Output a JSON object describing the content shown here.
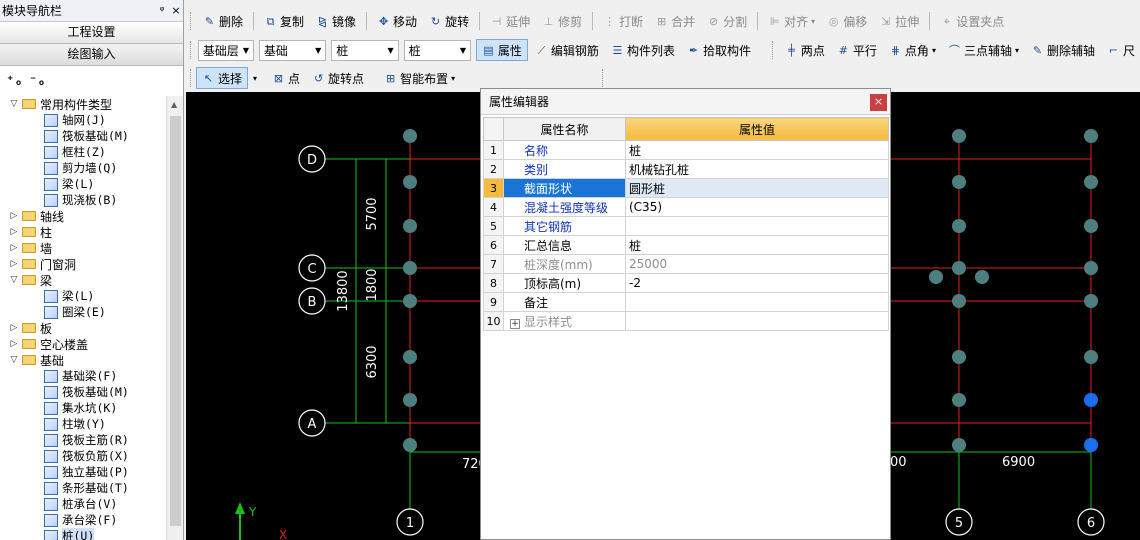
{
  "nav": {
    "title": "模块导航栏",
    "pin": "ᵠ",
    "close": "×",
    "btn_project": "工程设置",
    "btn_drawing": "绘图输入",
    "expand_all": "⁺ₒ",
    "collapse_all": "⁻ₒ",
    "tree": [
      {
        "level": 0,
        "exp": "▽",
        "label": "常用构件类型"
      },
      {
        "level": 1,
        "label": "轴网(J)"
      },
      {
        "level": 1,
        "label": "筏板基础(M)"
      },
      {
        "level": 1,
        "label": "框柱(Z)"
      },
      {
        "level": 1,
        "label": "剪力墙(Q)"
      },
      {
        "level": 1,
        "label": "梁(L)"
      },
      {
        "level": 1,
        "label": "现浇板(B)"
      },
      {
        "level": 0,
        "exp": "▷",
        "label": "轴线"
      },
      {
        "level": 0,
        "exp": "▷",
        "label": "柱"
      },
      {
        "level": 0,
        "exp": "▷",
        "label": "墙"
      },
      {
        "level": 0,
        "exp": "▷",
        "label": "门窗洞"
      },
      {
        "level": 0,
        "exp": "▽",
        "label": "梁"
      },
      {
        "level": 1,
        "label": "梁(L)"
      },
      {
        "level": 1,
        "label": "圈梁(E)"
      },
      {
        "level": 0,
        "exp": "▷",
        "label": "板"
      },
      {
        "level": 0,
        "exp": "▷",
        "label": "空心楼盖"
      },
      {
        "level": 0,
        "exp": "▽",
        "label": "基础"
      },
      {
        "level": 1,
        "label": "基础梁(F)"
      },
      {
        "level": 1,
        "label": "筏板基础(M)"
      },
      {
        "level": 1,
        "label": "集水坑(K)"
      },
      {
        "level": 1,
        "label": "柱墩(Y)"
      },
      {
        "level": 1,
        "label": "筏板主筋(R)"
      },
      {
        "level": 1,
        "label": "筏板负筋(X)"
      },
      {
        "level": 1,
        "label": "独立基础(P)"
      },
      {
        "level": 1,
        "label": "条形基础(T)"
      },
      {
        "level": 1,
        "label": "桩承台(V)"
      },
      {
        "level": 1,
        "label": "承台梁(F)"
      },
      {
        "level": 1,
        "label": "桩(U)",
        "selected": true
      }
    ]
  },
  "toolbar1": {
    "delete": "删除",
    "copy": "复制",
    "mirror": "镜像",
    "move": "移动",
    "rotate": "旋转",
    "extend": "延伸",
    "trim": "修剪",
    "break": "打断",
    "merge": "合并",
    "split": "分割",
    "align": "对齐",
    "offset": "偏移",
    "stretch": "拉伸",
    "set_grip": "设置夹点"
  },
  "toolbar2": {
    "floor": "基础层",
    "category": "基础",
    "type": "桩",
    "name": "桩",
    "properties": "属性",
    "edit_rebar": "编辑钢筋",
    "component_list": "构件列表",
    "pick": "拾取构件",
    "two_point": "两点",
    "parallel": "平行",
    "point_angle": "点角",
    "three_point_axis": "三点辅轴",
    "delete_axis": "删除辅轴",
    "more": "尺"
  },
  "toolbar3": {
    "select": "选择",
    "point": "点",
    "rotate_point": "旋转点",
    "smart_layout": "智能布置"
  },
  "drawing": {
    "axes_letters": [
      "D",
      "C",
      "B",
      "A"
    ],
    "axes_numbers": [
      "1",
      "5",
      "6"
    ],
    "dims_vertical": [
      "5700",
      "1800",
      "6300"
    ],
    "dim_total": "13800",
    "dims_horizontal": [
      "720",
      "00",
      "6900"
    ],
    "ucs_y": "Y",
    "ucs_x": "X"
  },
  "property_editor": {
    "title": "属性编辑器",
    "close": "×",
    "col_name": "属性名称",
    "col_value": "属性值",
    "rows": [
      {
        "num": "1",
        "name": "名称",
        "value": "桩",
        "style": "blue"
      },
      {
        "num": "2",
        "name": "类别",
        "value": "机械钻孔桩",
        "style": "blue"
      },
      {
        "num": "3",
        "name": "截面形状",
        "value": "圆形桩",
        "style": "blue",
        "selected": true
      },
      {
        "num": "4",
        "name": "混凝土强度等级",
        "value": "(C35)",
        "style": "blue"
      },
      {
        "num": "5",
        "name": "其它钢筋",
        "value": "",
        "style": "blue"
      },
      {
        "num": "6",
        "name": "汇总信息",
        "value": "桩",
        "style": "black"
      },
      {
        "num": "7",
        "name": "桩深度(mm)",
        "value": "25000",
        "style": "gray"
      },
      {
        "num": "8",
        "name": "顶标高(m)",
        "value": "-2",
        "style": "black"
      },
      {
        "num": "9",
        "name": "备注",
        "value": "",
        "style": "black"
      },
      {
        "num": "10",
        "name": "显示样式",
        "value": "",
        "style": "gray",
        "expandable": true
      }
    ]
  },
  "colors": {
    "canvas_bg": "#000000",
    "grid_line": "#e02020",
    "axis_green": "#19c019",
    "pile_teal": "#4d7f7f",
    "pile_selected": "#1a6ff0",
    "annotation_arrow": "#e8302a"
  }
}
